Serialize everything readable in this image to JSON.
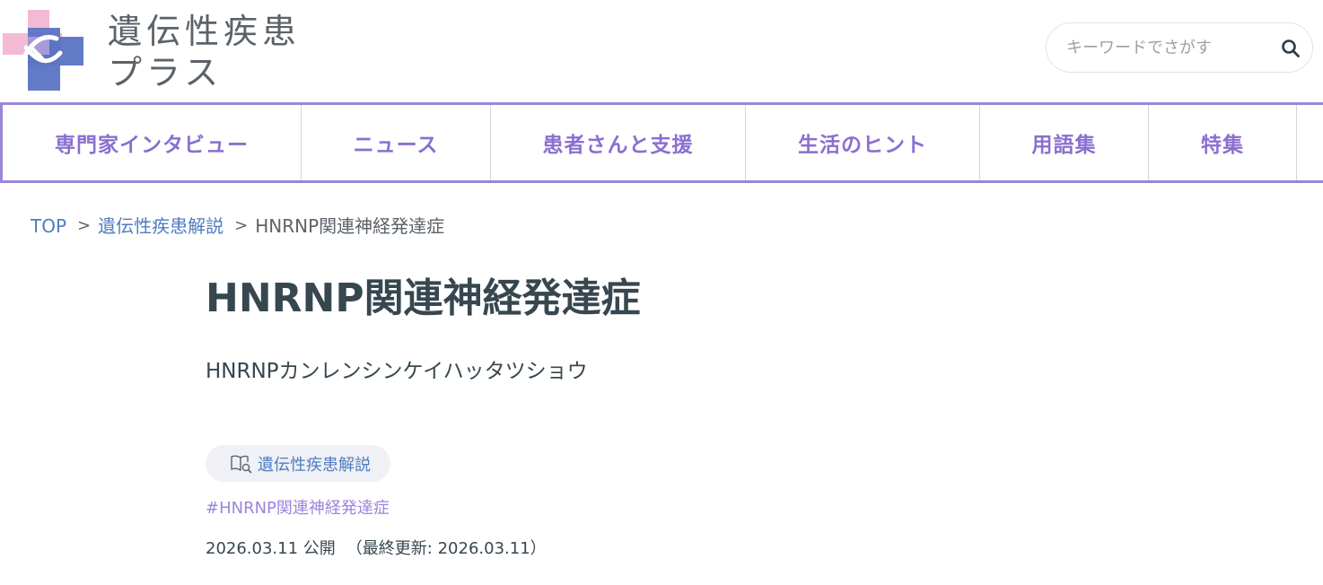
{
  "site": {
    "logo_line1": "遺伝性疾患",
    "logo_line2": "プラス",
    "colors": {
      "accent_purple": "#9b85db",
      "nav_text": "#8a6fd0",
      "link_blue": "#4f7cc1",
      "logo_pink": "#f4b9d3",
      "logo_blue": "#5b74c4",
      "text_dark": "#37474f"
    }
  },
  "search": {
    "placeholder": "キーワードでさがす",
    "icon": "search-icon"
  },
  "nav": {
    "items": [
      {
        "label": "専門家インタビュー"
      },
      {
        "label": "ニュース"
      },
      {
        "label": "患者さんと支援"
      },
      {
        "label": "生活のヒント"
      },
      {
        "label": "用語集"
      },
      {
        "label": "特集"
      }
    ]
  },
  "breadcrumb": {
    "items": [
      {
        "label": "TOP"
      },
      {
        "label": "遺伝性疾患解説"
      },
      {
        "label": "HNRNP関連神経発達症"
      }
    ],
    "separator": ">"
  },
  "article": {
    "title": "HNRNP関連神経発達症",
    "reading": "HNRNPカンレンシンケイハッタツショウ",
    "category": {
      "label": "遺伝性疾患解説",
      "icon": "book-search-icon"
    },
    "tag": "#HNRNP関連神経発達症",
    "published": "2026.03.11 公開",
    "updated": "（最終更新: 2026.03.11）"
  }
}
